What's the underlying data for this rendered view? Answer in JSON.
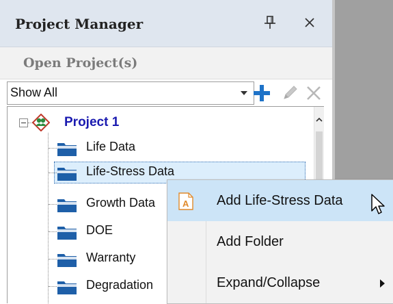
{
  "panel": {
    "title": "Project Manager",
    "open_projects_label": "Open Project(s)"
  },
  "toolbar": {
    "filter_value": "Show All"
  },
  "tree": {
    "project": {
      "label": "Project 1",
      "icon": "project-icon"
    },
    "items": [
      {
        "label": "Life Data",
        "icon": "folder-icon"
      },
      {
        "label": "Life-Stress Data",
        "icon": "folder-icon",
        "selected": true
      },
      {
        "label": "Growth Data",
        "icon": "folder-icon"
      },
      {
        "label": "DOE",
        "icon": "folder-icon"
      },
      {
        "label": "Warranty",
        "icon": "folder-icon"
      },
      {
        "label": "Degradation",
        "icon": "folder-icon"
      }
    ]
  },
  "context_menu": {
    "items": [
      {
        "label": "Add Life-Stress Data",
        "icon": "life-stress-document-icon",
        "highlighted": true
      },
      {
        "label": "Add Folder"
      },
      {
        "label": "Expand/Collapse",
        "has_submenu": true
      }
    ]
  },
  "colors": {
    "header_bg": "#dfe6ef",
    "project_label": "#1a1ab0",
    "folder_blue": "#1e5fa8",
    "add_plus": "#1e73c8",
    "menu_highlight": "#cce4f7",
    "side_gray": "#a0a0a0"
  }
}
